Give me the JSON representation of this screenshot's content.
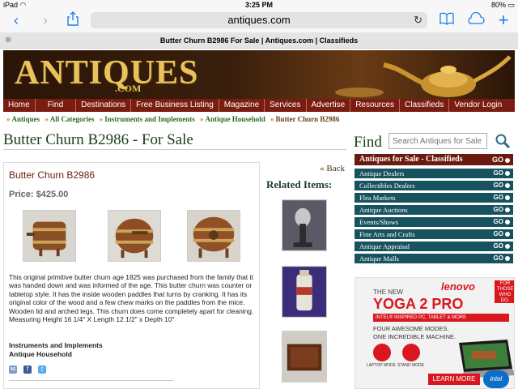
{
  "status_bar": {
    "device": "iPad",
    "wifi_icon": "wifi-icon",
    "time": "3:25 PM",
    "battery": "80%"
  },
  "browser": {
    "url": "antiques.com",
    "tab_title": "Butter Churn B2986 For Sale | Antiques.com | Classifieds"
  },
  "site": {
    "logo": "ANTIQUES",
    "logo_com": ".COM"
  },
  "nav": [
    "Home",
    "Find",
    "Destinations",
    "Free Business Listing",
    "Magazine",
    "Services",
    "Advertise",
    "Resources",
    "Classifieds",
    "Vendor Login"
  ],
  "breadcrumb": [
    "Antiques",
    "All Categories",
    "Instruments and Implements",
    "Antique Household",
    "Butter Churn B2986"
  ],
  "page_title": "Butter Churn B2986 - For Sale",
  "listing": {
    "title": "Butter Churn B2986",
    "price": "Price: $425.00",
    "description": "This original primitive butter churn age 1825 was purchased from the family that it was handed down and was informed of the age. This butter churn was counter or tabletop style. It has the inside wooden paddles that turns by cranking. It has its original color of the wood and a few chew marks on the paddles from the mice. Wooden lid and arched legs. This churn does come completely apart for cleaning. Measuring Height 16 1/4\" X Length 12 1/2\" x Depth 10\"",
    "category1": "Instruments and Implements",
    "category2": "Antique Household"
  },
  "related": {
    "back": "« Back",
    "title": "Related Items:"
  },
  "find": {
    "label": "Find",
    "placeholder": "Search Antiques for Sale"
  },
  "categories": {
    "header": "Antiques for Sale - Classifieds",
    "go": "GO",
    "items": [
      "Antique Dealers",
      "Collectibles Dealers",
      "Flea Markets",
      "Antique Auctions",
      "Events/Shows",
      "Fine Arts and Crafts",
      "Antique Appraisal",
      "Antique Malls"
    ]
  },
  "ad": {
    "the_new": "THE NEW",
    "brand": "lenovo",
    "for_badge": "FOR THOSE WHO DO.",
    "model": "YOGA 2 PRO",
    "sub": "INTEL® INSPIRED PC, TABLET & MORE",
    "line1": "FOUR AWESOME MODES.",
    "line2": "ONE INCREDIBLE MACHINE.",
    "modes": [
      "LAPTOP MODE",
      "STAND MODE"
    ],
    "cta": "LEARN MORE",
    "intel": "intel"
  }
}
